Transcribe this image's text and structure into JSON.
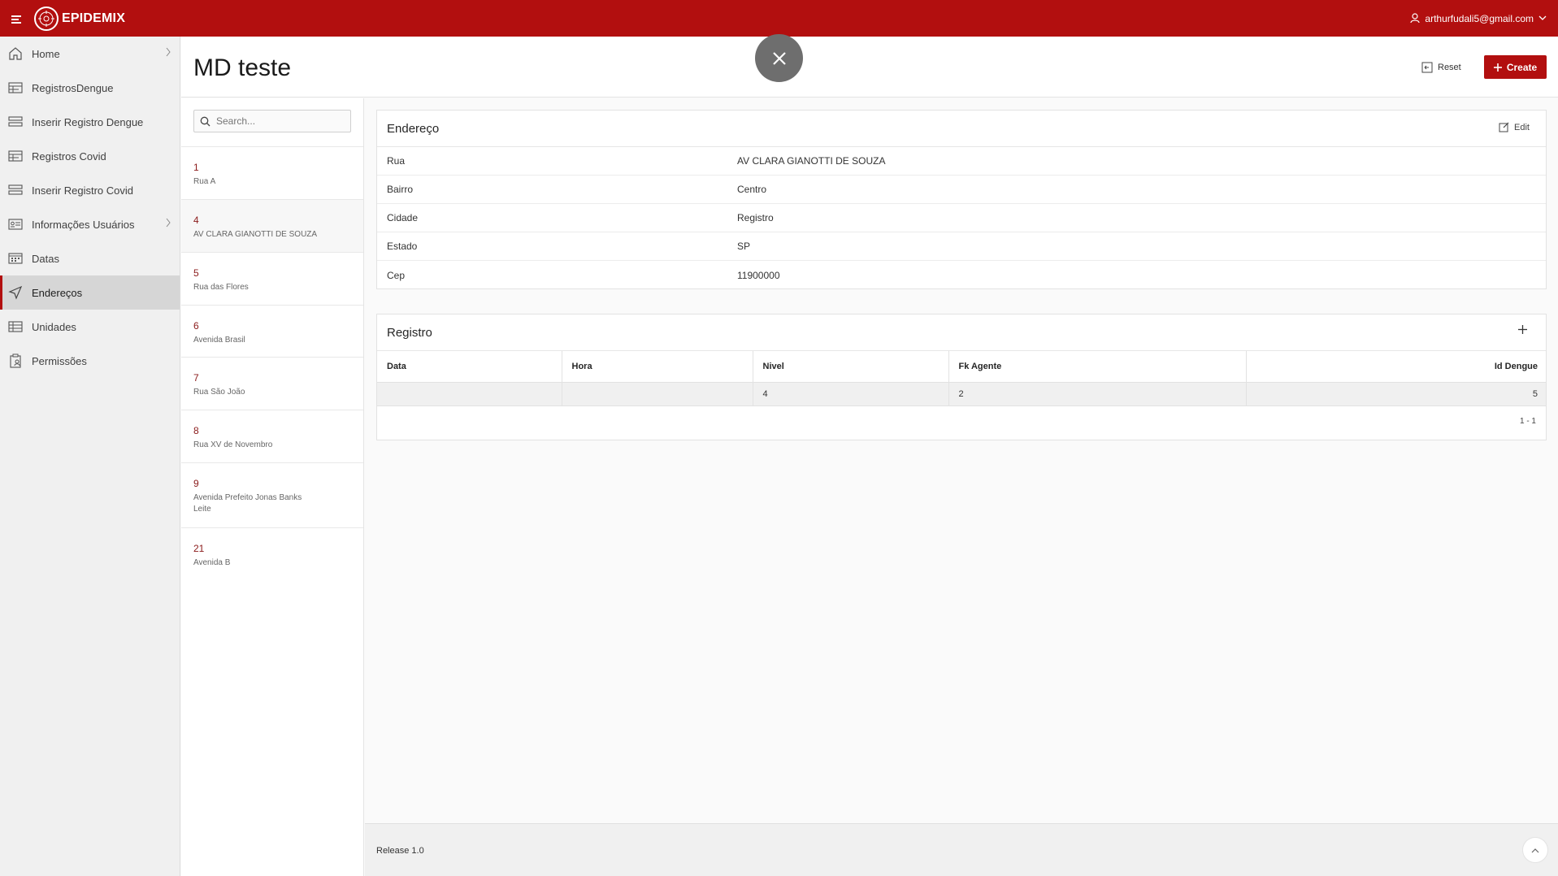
{
  "header": {
    "app_title": "EPIDEMIX",
    "user_email": "arthurfudali5@gmail.com",
    "brand_color": "#b20f0f"
  },
  "sidebar": {
    "items": [
      {
        "label": "Home",
        "icon": "home-icon",
        "has_children": true
      },
      {
        "label": "RegistrosDengue",
        "icon": "table-icon",
        "has_children": false
      },
      {
        "label": "Inserir Registro Dengue",
        "icon": "form-icon",
        "has_children": false
      },
      {
        "label": "Registros Covid",
        "icon": "table-icon",
        "has_children": false
      },
      {
        "label": "Inserir Registro Covid",
        "icon": "form-icon",
        "has_children": false
      },
      {
        "label": "Informações Usuários",
        "icon": "id-card-icon",
        "has_children": true
      },
      {
        "label": "Datas",
        "icon": "calendar-icon",
        "has_children": false
      },
      {
        "label": "Endereços",
        "icon": "navigation-icon",
        "has_children": false,
        "active": true
      },
      {
        "label": "Unidades",
        "icon": "grid-icon",
        "has_children": false
      },
      {
        "label": "Permissões",
        "icon": "clipboard-user-icon",
        "has_children": false
      }
    ]
  },
  "page": {
    "title": "MD teste",
    "reset_label": "Reset",
    "create_label": "Create"
  },
  "master": {
    "search_placeholder": "Search...",
    "items": [
      {
        "id": "1",
        "desc": "Rua A"
      },
      {
        "id": "4",
        "desc": "AV CLARA GIANOTTI DE SOUZA",
        "selected": true
      },
      {
        "id": "5",
        "desc": "Rua das Flores"
      },
      {
        "id": "6",
        "desc": "Avenida Brasil"
      },
      {
        "id": "7",
        "desc": "Rua São João"
      },
      {
        "id": "8",
        "desc": "Rua XV de Novembro"
      },
      {
        "id": "9",
        "desc": "Avenida Prefeito Jonas Banks Leite"
      },
      {
        "id": "21",
        "desc": "Avenida B"
      }
    ]
  },
  "detail": {
    "endereco": {
      "title": "Endereço",
      "edit_label": "Edit",
      "fields": [
        {
          "label": "Rua",
          "value": "AV CLARA GIANOTTI DE SOUZA"
        },
        {
          "label": "Bairro",
          "value": "Centro"
        },
        {
          "label": "Cidade",
          "value": "Registro"
        },
        {
          "label": "Estado",
          "value": "SP"
        },
        {
          "label": "Cep",
          "value": "11900000"
        }
      ]
    },
    "registro": {
      "title": "Registro",
      "columns": [
        "Data",
        "Hora",
        "Nivel",
        "Fk Agente",
        "Id Dengue"
      ],
      "rows": [
        [
          "",
          "",
          "4",
          "2",
          "5"
        ]
      ],
      "pagination": "1 - 1"
    }
  },
  "footer": {
    "release": "Release 1.0"
  }
}
